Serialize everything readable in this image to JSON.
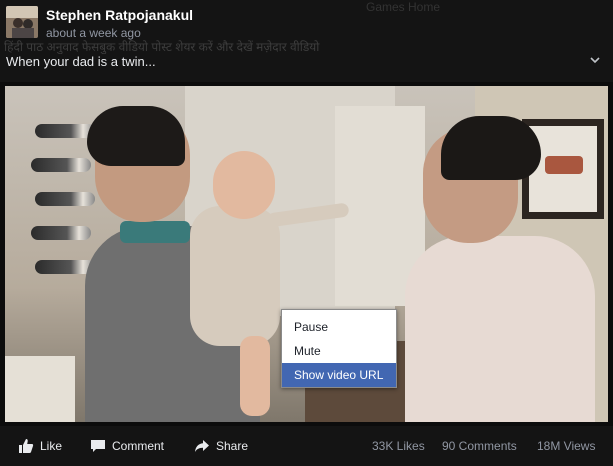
{
  "post": {
    "author": "Stephen Ratpojanakul",
    "timestamp": "about a week ago",
    "caption": "When your dad is a twin...",
    "ghost_text": "हिंदी  पाठ  अनुवाद  फेसबुक  वीडियो  पोस्ट  शेयर  करें  और  देखें  मज़ेदार  वीडियो",
    "ghost_nav": "Games      Home"
  },
  "context_menu": {
    "items": [
      {
        "label": "Pause",
        "active": false
      },
      {
        "label": "Mute",
        "active": false
      },
      {
        "label": "Show video URL",
        "active": true
      }
    ]
  },
  "actions": {
    "like_label": "Like",
    "comment_label": "Comment",
    "share_label": "Share"
  },
  "stats": {
    "likes": "33K Likes",
    "comments": "90 Comments",
    "views": "18M Views"
  },
  "colors": {
    "menu_highlight": "#4267b2",
    "background": "#141414"
  }
}
